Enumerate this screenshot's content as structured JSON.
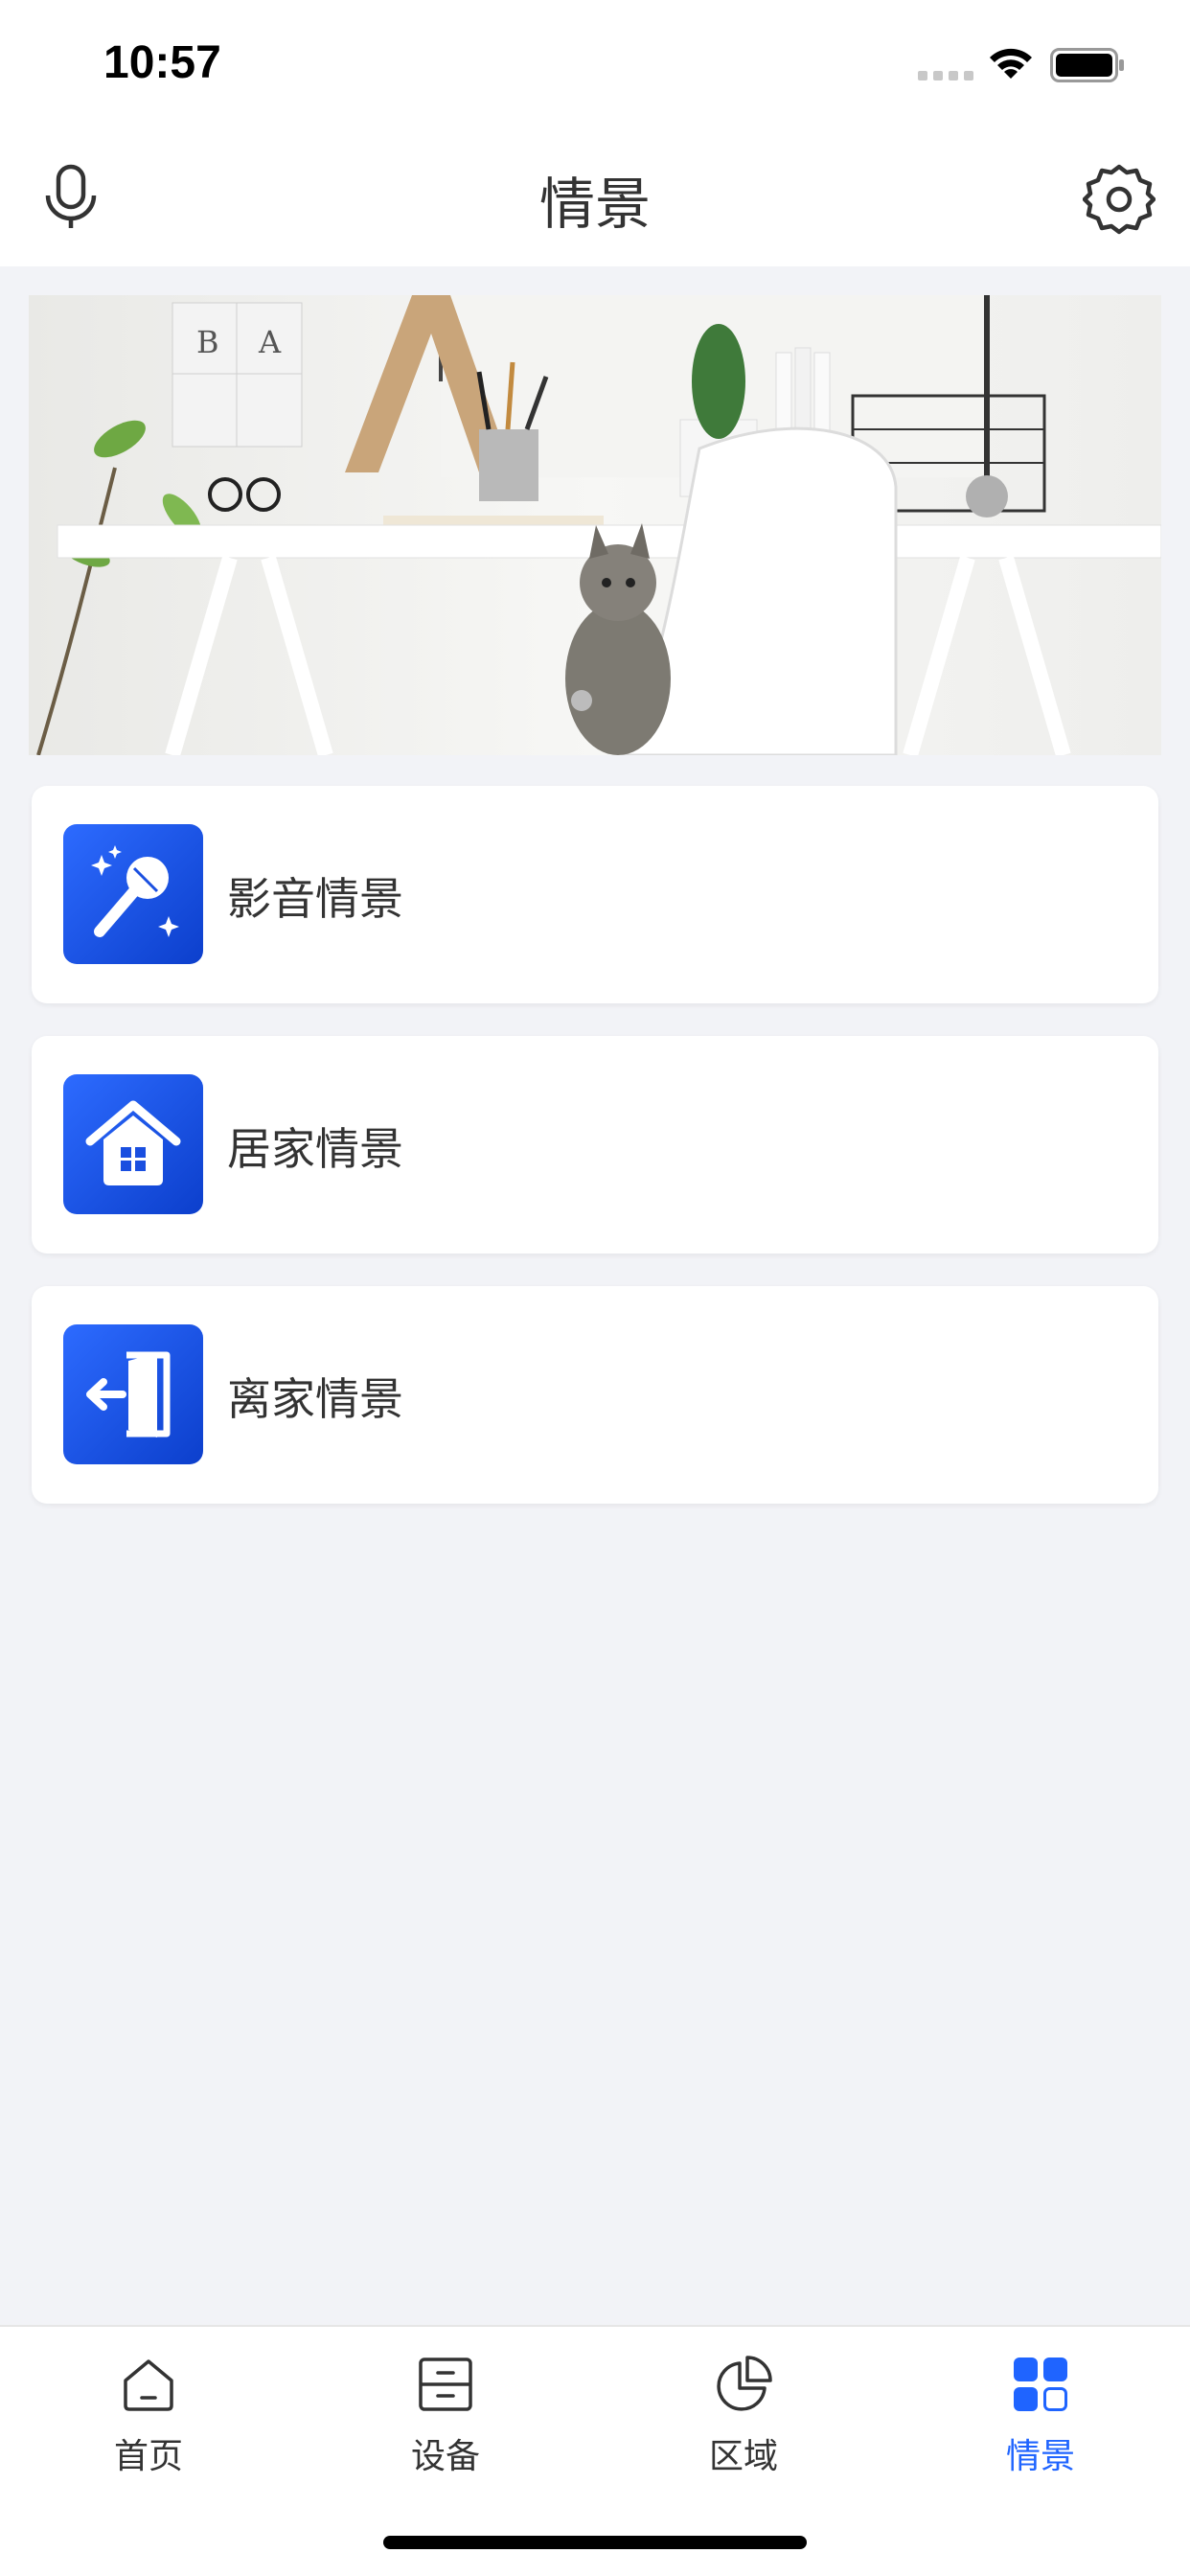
{
  "status_bar": {
    "time": "10:57"
  },
  "nav": {
    "title": "情景",
    "left_icon": "microphone-icon",
    "right_icon": "gear-icon"
  },
  "scenes": [
    {
      "label": "影音情景",
      "icon": "microphone-sparkle-icon"
    },
    {
      "label": "居家情景",
      "icon": "house-icon"
    },
    {
      "label": "离家情景",
      "icon": "door-exit-icon"
    }
  ],
  "tabs": [
    {
      "label": "首页",
      "icon": "home-icon",
      "active": false
    },
    {
      "label": "设备",
      "icon": "device-list-icon",
      "active": false
    },
    {
      "label": "区域",
      "icon": "pie-chart-icon",
      "active": false
    },
    {
      "label": "情景",
      "icon": "grid-icon",
      "active": true
    }
  ],
  "colors": {
    "accent": "#1f64ff",
    "icon_gradient_start": "#2d6bff",
    "icon_gradient_end": "#0c3fcc",
    "background": "#f2f3f7"
  }
}
